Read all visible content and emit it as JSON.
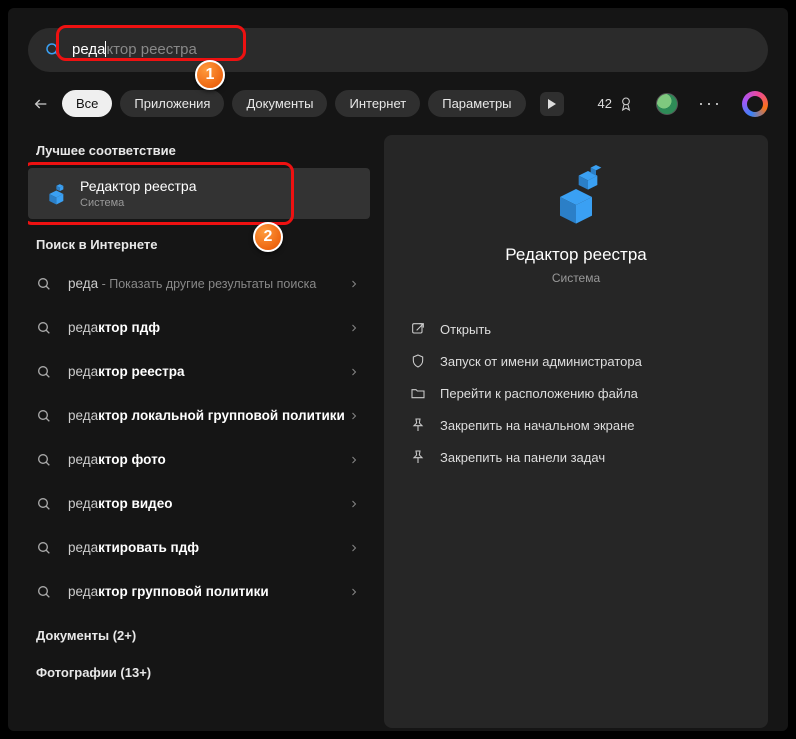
{
  "search": {
    "typed": "реда",
    "suggestion_rest": "ктор реестра"
  },
  "tabs": {
    "all": "Все",
    "apps": "Приложения",
    "docs": "Документы",
    "web": "Интернет",
    "settings": "Параметры"
  },
  "points": "42",
  "more": "···",
  "left": {
    "best_match_header": "Лучшее соответствие",
    "best_title": "Редактор реестра",
    "best_sub": "Система",
    "web_header": "Поиск в Интернете",
    "web_items": [
      {
        "q": "реда",
        "bold": "",
        "hint": " - Показать другие результаты поиска"
      },
      {
        "q": "реда",
        "bold": "ктор пдф",
        "hint": ""
      },
      {
        "q": "реда",
        "bold": "ктор реестра",
        "hint": ""
      },
      {
        "q": "реда",
        "bold": "ктор локальной групповой политики",
        "hint": ""
      },
      {
        "q": "реда",
        "bold": "ктор фото",
        "hint": ""
      },
      {
        "q": "реда",
        "bold": "ктор видео",
        "hint": ""
      },
      {
        "q": "реда",
        "bold": "ктировать пдф",
        "hint": ""
      },
      {
        "q": "реда",
        "bold": "ктор групповой политики",
        "hint": ""
      }
    ],
    "docs_header": "Документы (2+)",
    "photos_header": "Фотографии (13+)"
  },
  "preview": {
    "title": "Редактор реестра",
    "sub": "Система",
    "actions": {
      "open": "Открыть",
      "admin": "Запуск от имени администратора",
      "location": "Перейти к расположению файла",
      "pin_start": "Закрепить на начальном экране",
      "pin_taskbar": "Закрепить на панели задач"
    }
  }
}
